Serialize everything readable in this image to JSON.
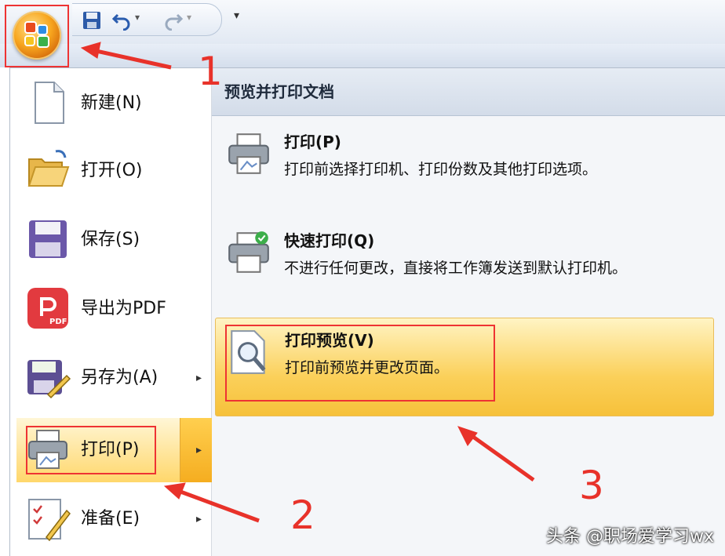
{
  "menu": {
    "left_items": [
      {
        "label": "新建(N)",
        "icon": "new-document-icon",
        "submenu": false
      },
      {
        "label": "打开(O)",
        "icon": "open-folder-icon",
        "submenu": false
      },
      {
        "label": "保存(S)",
        "icon": "save-floppy-icon",
        "submenu": false
      },
      {
        "label": "导出为PDF",
        "icon": "pdf-export-icon",
        "submenu": false
      },
      {
        "label": "另存为(A)",
        "icon": "save-as-icon",
        "submenu": true
      },
      {
        "label": "打印(P)",
        "icon": "printer-icon",
        "submenu": true,
        "selected": true
      },
      {
        "label": "准备(E)",
        "icon": "prepare-icon",
        "submenu": true
      }
    ],
    "arrow_glyph": "▸",
    "pdf_badge": "PDF"
  },
  "submenu": {
    "header": "预览并打印文档",
    "items": [
      {
        "title": "打印(P)",
        "desc": "打印前选择打印机、打印份数及其他打印选项。",
        "icon": "printer-icon"
      },
      {
        "title": "快速打印(Q)",
        "desc": "不进行任何更改，直接将工作簿发送到默认打印机。",
        "icon": "quick-print-icon"
      },
      {
        "title": "打印预览(V)",
        "desc": "打印前预览并更改页面。",
        "icon": "print-preview-icon",
        "selected": true
      }
    ]
  },
  "qat": {
    "customize_glyph": "▾"
  },
  "annotations": {
    "step1": "1",
    "step2": "2",
    "step3": "3",
    "color": "#e8322a"
  },
  "watermark": "头条 @职场爱学习wx"
}
